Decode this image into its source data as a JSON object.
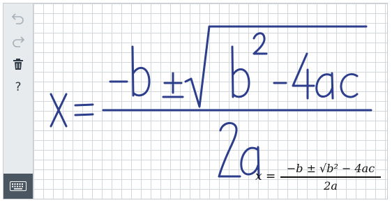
{
  "toolbar": {
    "undo_icon": "undo-icon",
    "redo_icon": "redo-icon",
    "clear_icon": "trash-icon",
    "help_label": "?",
    "keyboard_icon": "keyboard-icon"
  },
  "ink": {
    "color": "#2c3e8c"
  },
  "result": {
    "lhs": "x =",
    "numerator": "−b ± √b² − 4ac",
    "denominator": "2a"
  }
}
